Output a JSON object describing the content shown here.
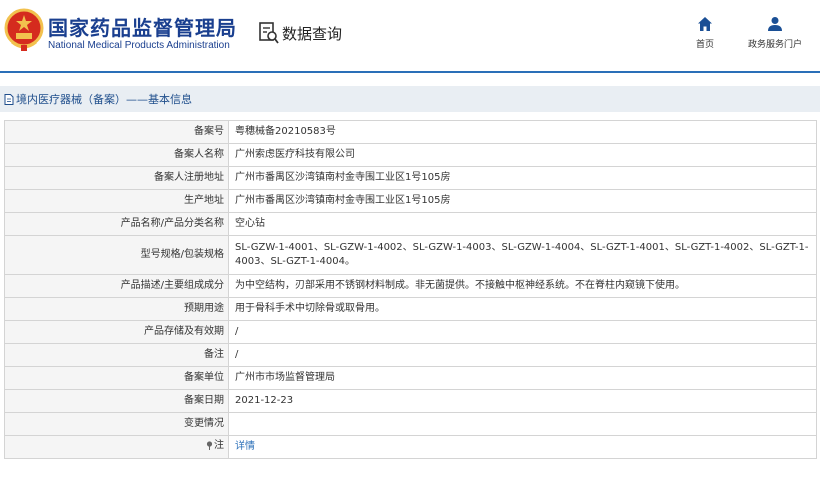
{
  "header": {
    "title_cn": "国家药品监督管理局",
    "title_en": "National Medical Products Administration",
    "query_label": "数据查询",
    "nav": {
      "home_label": "首页",
      "portal_label": "政务服务门户"
    }
  },
  "colors": {
    "brand_blue": "#1a3f8f",
    "accent_blue": "#2a6fb8",
    "emblem_red": "#d52b1e",
    "emblem_gold": "#f2c14e"
  },
  "icons": {
    "emblem": "national-emblem",
    "query": "document-search-icon",
    "home": "home-icon",
    "portal": "user-icon",
    "breadcrumb": "document-icon",
    "note": "pin-icon"
  },
  "breadcrumb": {
    "text": "境内医疗器械（备案）——基本信息"
  },
  "rows": [
    {
      "label": "备案号",
      "value": "粤穗械备20210583号"
    },
    {
      "label": "备案人名称",
      "value": "广州索虑医疗科技有限公司"
    },
    {
      "label": "备案人注册地址",
      "value": "广州市番禺区沙湾镇南村金寺围工业区1号105房"
    },
    {
      "label": "生产地址",
      "value": "广州市番禺区沙湾镇南村金寺围工业区1号105房"
    },
    {
      "label": "产品名称/产品分类名称",
      "value": "空心钻"
    },
    {
      "label": "型号规格/包装规格",
      "value": "SL-GZW-1-4001、SL-GZW-1-4002、SL-GZW-1-4003、SL-GZW-1-4004、SL-GZT-1-4001、SL-GZT-1-4002、SL-GZT-1-4003、SL-GZT-1-4004。"
    },
    {
      "label": "产品描述/主要组成成分",
      "value": "为中空结构，刃部采用不锈钢材料制成。非无菌提供。不接触中枢神经系统。不在脊柱内窥镜下使用。"
    },
    {
      "label": "预期用途",
      "value": "用于骨科手术中切除骨或取骨用。"
    },
    {
      "label": "产品存储及有效期",
      "value": "/"
    },
    {
      "label": "备注",
      "value": "/"
    },
    {
      "label": "备案单位",
      "value": "广州市市场监督管理局"
    },
    {
      "label": "备案日期",
      "value": "2021-12-23"
    },
    {
      "label": "变更情况",
      "value": ""
    }
  ],
  "note_row": {
    "label": "注",
    "link_text": "详情"
  }
}
